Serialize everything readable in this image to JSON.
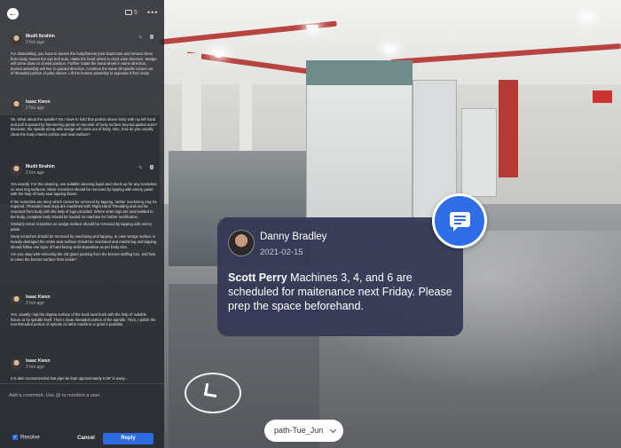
{
  "panel": {
    "comment_count": "5",
    "more_label": "•••",
    "comments": [
      {
        "author": "Mudit Ibrahim",
        "time": "2 hrs ago",
        "paragraphs": [
          "For dismantling, you have to loosen the body/bonnet joint studs/nuts and remove them from body, loosen the eye bolt nuts, rotate the hand wheel in clock wise direction. Wedge will come down to closed position. Further rotate the hand wheel in same direction, bonnet assembly will rise in upward direction. Continue the same till spindle comes out of threaded portion of yoke sleeve. Lift the bonnet assembly to separate it from body."
        ]
      },
      {
        "author": "Isaac Kwon",
        "time": "2 hrs ago",
        "paragraphs": [
          "Ok. What about the spindle? Do I have to hold that portion above body with my left hand and pull it upward by hammering gently on top-side of body surface beyond gasket area? Because, the spindle along with wedge will come out of body. Also, how do you usually clean the body interior portion and seat surface?"
        ]
      },
      {
        "author": "Mudit Ibrahim",
        "time": "2 hrs ago",
        "paragraphs": [
          "Yes exactly. For the cleaning, use suitable cleaning liquid and check up for any scratches on seat ring surfaces. Minor scratches should be removed by lapping with emery paste with the help of body seat lapping fixture.",
          "If the scratches are deep which cannot be removed by lapping, further machining may be required. Threaded seat rings are machined with 'Right Hand Threading and can be removed from body with the help of lugs provided. Where seat rings are seal welded to the body, complete body should be loaded on machine for further rectification.",
          "Similarly minor scratches on wedge surface should be removed by lapping with emery paste.",
          "Deep scratches should be removed by machining and lapping. In case wedge surface is heavily damaged the entire seat surface should be machined and machining and lapping should follow one layer of hard facing weld deposition as per body size.",
          "Are you okay with removing the old gland packing from the bonnet stuffing box, and how to clean the bonnet surface from inside?"
        ]
      },
      {
        "author": "Isaac Kwon",
        "time": "2 hrs ago",
        "paragraphs": [
          "Yes, usually I lap the dogma surface of the back seat bush with the help of suitable fixture or by spindle itself. Then I clean threaded portion of the spindle. Then, I polish the non-threaded portion of spindle on lathe machine or grind it possible."
        ]
      },
      {
        "author": "Isaac Kwon",
        "time": "2 hrs ago",
        "paragraphs": [
          "It is also recommended that pipe be kept approximately 0.08\" in away..."
        ]
      }
    ],
    "composer": {
      "placeholder": "Add a comment. Use @ to mention a user.",
      "resolve_label": "Resolve",
      "cancel_label": "Cancel",
      "reply_label": "Reply"
    }
  },
  "card": {
    "author": "Danny Bradley",
    "date": "2021-02-15",
    "mention": "Scott Perry",
    "message": " Machines 3, 4, and 6 are scheduled for maitenance next Friday. Please prep the space beforehand."
  },
  "path_select": {
    "value": "path-Tue_Jun_1"
  },
  "icons": {
    "back": "arrow-left-icon",
    "comments": "comment-count-icon",
    "bubble": "chat-bubble-icon",
    "navigation": "navigation-arrow-icon",
    "dropdown": "chevron-down-icon"
  },
  "colors": {
    "accent": "#2f6be0",
    "bubble": "#2d6ee6",
    "card_bg": "#343754",
    "panel_bg": "#24262c"
  }
}
